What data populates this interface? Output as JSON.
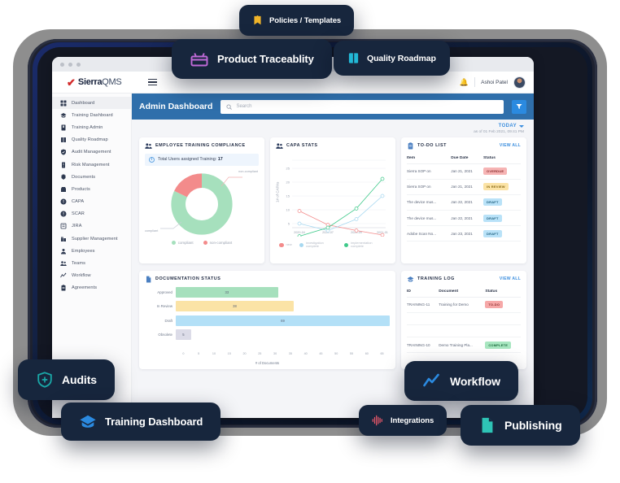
{
  "app": {
    "logo_check": "✔",
    "logo_sierra": "Sierra",
    "logo_qms": "QMS",
    "user_name": "Ashoi Patel",
    "bell_icon": "bell-icon",
    "menu_icon": "hamburger-icon"
  },
  "sidebar": {
    "items": [
      {
        "label": "Dashboard",
        "icon": "grid-icon",
        "active": true
      },
      {
        "label": "Training Dashboard",
        "icon": "graduation-cap-icon",
        "active": false
      },
      {
        "label": "Training Admin",
        "icon": "book-icon",
        "active": false
      },
      {
        "label": "Quality Roadmap",
        "icon": "open-book-icon",
        "active": false
      },
      {
        "label": "Audit Management",
        "icon": "shield-check-icon",
        "active": false
      },
      {
        "label": "Risk Management",
        "icon": "alert-icon",
        "active": false
      },
      {
        "label": "Documents",
        "icon": "documents-icon",
        "active": false
      },
      {
        "label": "Products",
        "icon": "box-icon",
        "active": false
      },
      {
        "label": "CAPA",
        "icon": "exclamation-circle-icon",
        "active": false
      },
      {
        "label": "SCAR",
        "icon": "exclamation-circle-icon",
        "active": false
      },
      {
        "label": "JIRA",
        "icon": "list-box-icon",
        "active": false
      },
      {
        "label": "Supplier Management",
        "icon": "building-icon",
        "active": false
      },
      {
        "label": "Employees",
        "icon": "person-icon",
        "active": false
      },
      {
        "label": "Teams",
        "icon": "people-icon",
        "active": false
      },
      {
        "label": "Workflow",
        "icon": "workflow-icon",
        "active": false
      },
      {
        "label": "Agreements",
        "icon": "clipboard-icon",
        "active": false
      }
    ]
  },
  "page": {
    "title": "Admin Dashboard",
    "search_placeholder": "Search",
    "search_value": "",
    "search_icon": "search-icon",
    "filter_icon": "filter-icon",
    "today_label": "TODAY",
    "as_of": "as of 01 Feb 2021, 09:41 PM"
  },
  "cards": {
    "training_compliance": {
      "title": "EMPLOYEE TRAINING COMPLIANCE",
      "icon": "people-icon",
      "info_text": "Total Users assigned Training: ",
      "info_value": "17",
      "label_noncompliant": "non-compliant",
      "label_compliant": "compliant"
    },
    "capa_stats": {
      "title": "CAPA STATS",
      "icon": "people-icon"
    },
    "todo_list": {
      "title": "TO-DO LIST",
      "icon": "clipboard-icon",
      "view_all": "VIEW ALL",
      "columns": [
        "Item",
        "Due Date",
        "Status"
      ],
      "rows": [
        {
          "item": "Sierra SOP on",
          "due": "Jan 21, 2021",
          "status": "OVERDUE",
          "status_class": "b-overdue"
        },
        {
          "item": "Sierra SOP on",
          "due": "Jan 21, 2021",
          "status": "IN REVIEW",
          "status_class": "b-review"
        },
        {
          "item": "The device mus...",
          "due": "Jan 22, 2021",
          "status": "DRAFT",
          "status_class": "b-draft"
        },
        {
          "item": "The device mus...",
          "due": "Jan 22, 2021",
          "status": "DRAFT",
          "status_class": "b-draft"
        },
        {
          "item": "Adobe Scan No...",
          "due": "Jan 23, 2021",
          "status": "DRAFT",
          "status_class": "b-draft"
        }
      ]
    },
    "documentation_status": {
      "title": "DOCUMENTATION STATUS",
      "icon": "document-icon"
    },
    "training_log": {
      "title": "TRAINING LOG",
      "icon": "graduation-cap-icon",
      "view_all": "VIEW ALL",
      "columns": [
        "ID",
        "Document",
        "Status"
      ],
      "rows": [
        {
          "id": "TRAINING-11",
          "document": "Training for Demo",
          "status": "TO-DO",
          "status_class": "b-todo"
        },
        {
          "id": "TRAINING-10",
          "document": "Demo Training Pla...",
          "status": "COMPLETE",
          "status_class": "b-complete"
        }
      ]
    }
  },
  "chart_data": [
    {
      "type": "pie",
      "title": "EMPLOYEE TRAINING COMPLIANCE",
      "labels": [
        "compliant",
        "non-compliant"
      ],
      "values": [
        82,
        18
      ],
      "colors": [
        "#a6e0bd",
        "#f38b8b"
      ],
      "legend": [
        "compliant",
        "non-compliant"
      ],
      "donut": true,
      "annotations": [
        "non-compliant",
        "compliant"
      ]
    },
    {
      "type": "line",
      "title": "CAPA STATS",
      "xlabel": "",
      "ylabel": "# of CAPAs",
      "x": [
        "2020-04",
        "2020-07",
        "2020-09",
        "2021-01"
      ],
      "ylim": [
        0,
        25
      ],
      "yticks": [
        5,
        10,
        15,
        20,
        25
      ],
      "grid": true,
      "legend_position": "bottom",
      "series": [
        {
          "name": "new",
          "values": [
            9.5,
            6,
            4,
            1.5
          ],
          "color": "#f38b8b"
        },
        {
          "name": "investigation complete",
          "values": [
            5,
            3.5,
            6.5,
            11.5
          ],
          "color": "#a7d8f0"
        },
        {
          "name": "implementation complete",
          "values": [
            0.5,
            4,
            10.5,
            19
          ],
          "color": "#3fc98a"
        }
      ]
    },
    {
      "type": "bar",
      "title": "DOCUMENTATION STATUS",
      "orientation": "horizontal",
      "categories": [
        "Approved",
        "In Review",
        "Draft",
        "Obsolete"
      ],
      "values": [
        33,
        38,
        69,
        5
      ],
      "colors": [
        "#a6e0bd",
        "#fbe3a6",
        "#b3e0f7",
        "#dcdce8"
      ],
      "xlabel": "# of Documents",
      "ylabel": "",
      "xlim": [
        0,
        69
      ],
      "xticks": [
        0,
        5,
        10,
        15,
        20,
        25,
        30,
        35,
        40,
        45,
        50,
        55,
        60,
        65
      ],
      "grid": true
    }
  ],
  "pills": [
    {
      "key": "policies",
      "label": "Policies / Templates",
      "icon": "bookmark-icon",
      "color": "#f0b429"
    },
    {
      "key": "traceability",
      "label": "Product Traceablity",
      "icon": "traceability-icon",
      "color": "#c06ad8"
    },
    {
      "key": "roadmap",
      "label": "Quality Roadmap",
      "icon": "open-book-icon",
      "color": "#22b8d6"
    },
    {
      "key": "audits",
      "label": "Audits",
      "icon": "shield-icon",
      "color": "#1aa8a8"
    },
    {
      "key": "training",
      "label": "Training Dashboard",
      "icon": "graduation-cap-icon",
      "color": "#2b8ae0"
    },
    {
      "key": "workflow",
      "label": "Workflow",
      "icon": "workflow-icon",
      "color": "#2b8ae0"
    },
    {
      "key": "integrations",
      "label": "Integrations",
      "icon": "waveform-icon",
      "color": "#e8586a"
    },
    {
      "key": "publishing",
      "label": "Publishing",
      "icon": "document-icon",
      "color": "#2ec4b6"
    }
  ]
}
